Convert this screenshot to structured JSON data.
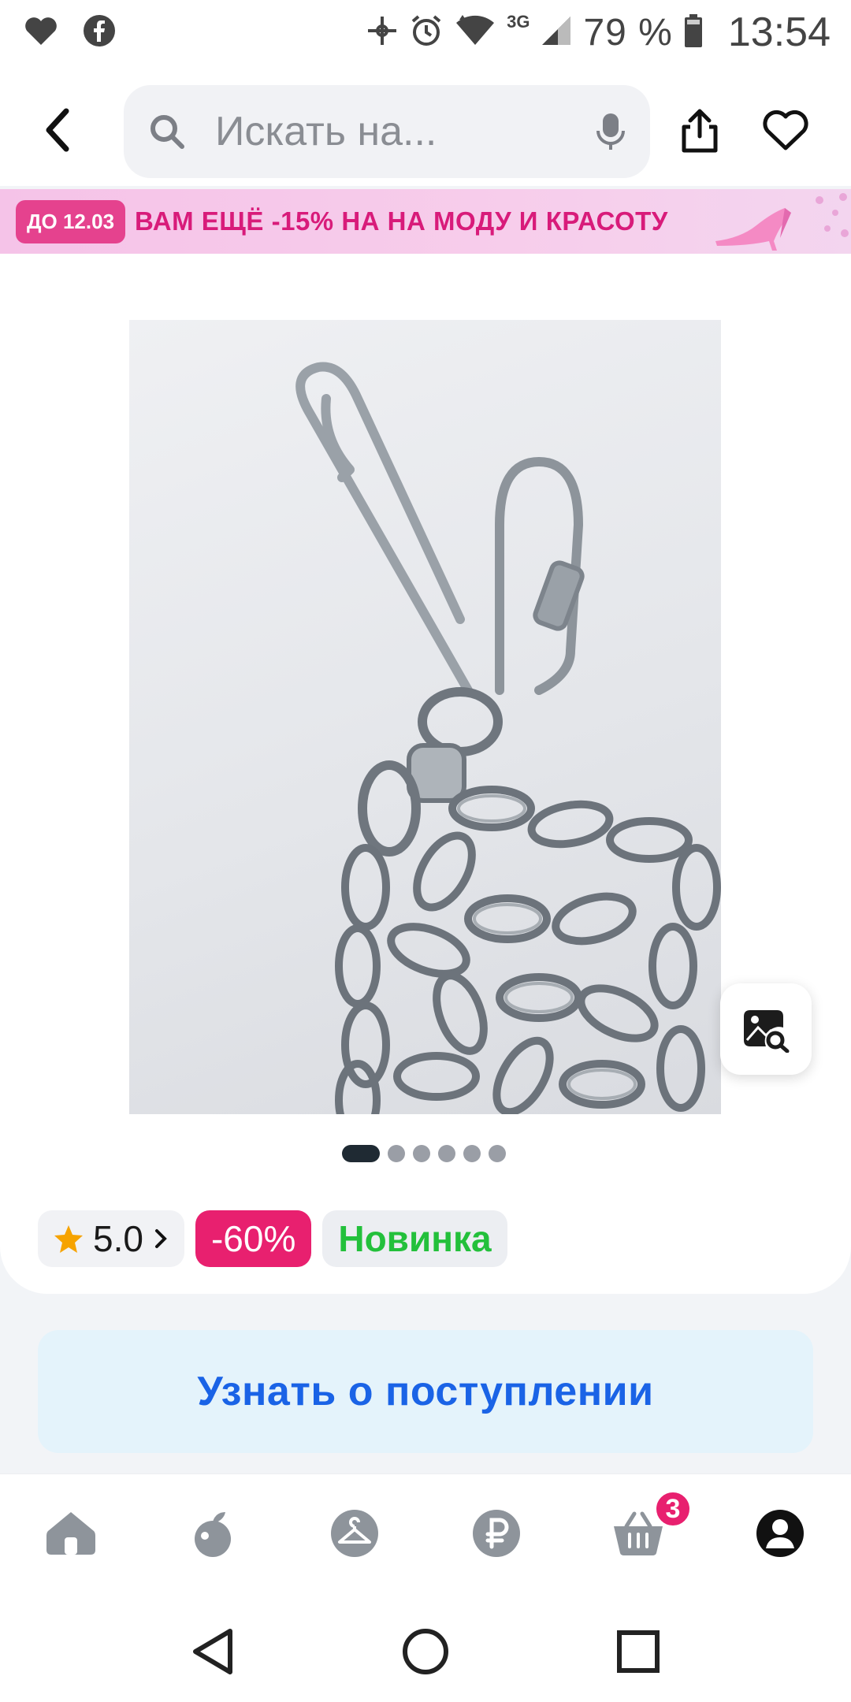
{
  "status_bar": {
    "battery": "79 %",
    "time": "13:54",
    "network": "3G",
    "icons": [
      "heart-icon",
      "facebook-icon",
      "vpn-icon",
      "alarm-icon",
      "wifi-icon",
      "signal-icon",
      "battery-icon"
    ]
  },
  "header": {
    "search_placeholder": "Искать на...",
    "icons": [
      "back-icon",
      "search-icon",
      "mic-icon",
      "share-icon",
      "heart-icon"
    ]
  },
  "promo": {
    "badge": "ДО 12.03",
    "text": "ВАМ ЕЩЁ -15% НА НА МОДУ И КРАСОТУ"
  },
  "product": {
    "gallery_total": 6,
    "gallery_current": 1,
    "rating": "5.0",
    "discount": "-60%",
    "new_label": "Новинка"
  },
  "actions": {
    "notify_label": "Узнать о поступлении"
  },
  "bottom_nav": {
    "items": [
      "home-icon",
      "fruit-icon",
      "hanger-icon",
      "ruble-icon",
      "cart-icon",
      "profile-icon"
    ],
    "cart_count": "3"
  },
  "colors": {
    "accent_pink": "#e8206f",
    "accent_blue": "#1a63e6",
    "new_green": "#23c03b",
    "promo_pink": "#d81b7a"
  }
}
